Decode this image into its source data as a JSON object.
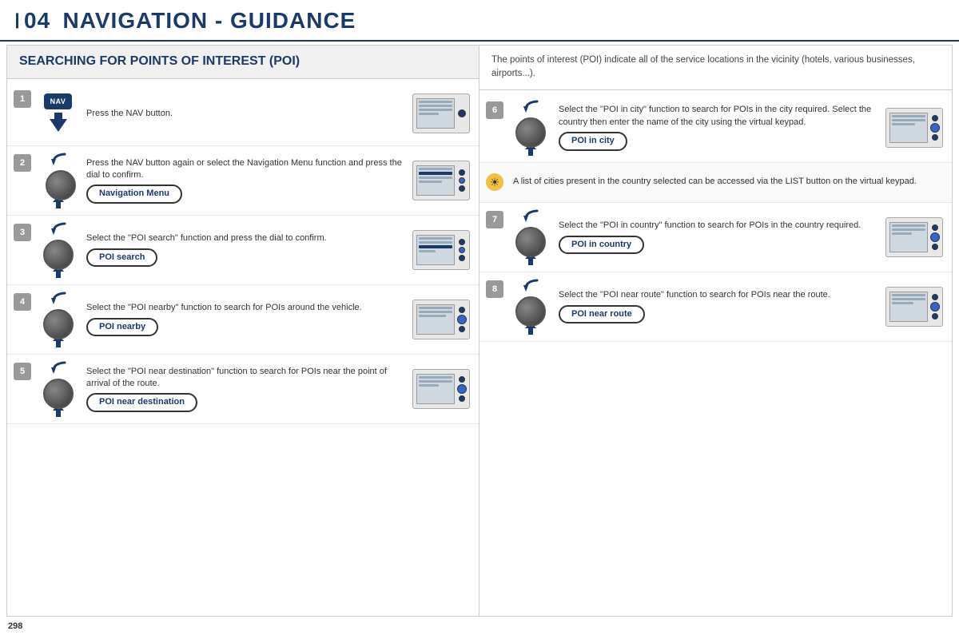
{
  "header": {
    "chapter": "04",
    "title": "NAVIGATION - GUIDANCE"
  },
  "left_section": {
    "heading": "SEARCHING FOR POINTS OF INTEREST (POI)"
  },
  "right_section": {
    "intro": "The points of interest (POI) indicate all of the service locations in the vicinity (hotels, various businesses, airports...)."
  },
  "steps_left": [
    {
      "number": "1",
      "has_nav_btn": true,
      "nav_btn_label": "NAV",
      "text": "Press the NAV button.",
      "badge": null
    },
    {
      "number": "2",
      "has_nav_btn": false,
      "text": "Press the NAV button again or select the Navigation Menu function and press the dial to confirm.",
      "badge": "Navigation Menu"
    },
    {
      "number": "3",
      "has_nav_btn": false,
      "text": "Select the \"POI search\" function and press the dial to confirm.",
      "badge": "POI search"
    },
    {
      "number": "4",
      "has_nav_btn": false,
      "text": "Select the \"POI nearby\" function to search for POIs around the vehicle.",
      "badge": "POI nearby"
    },
    {
      "number": "5",
      "has_nav_btn": false,
      "text": "Select the \"POI near destination\" function to search for POIs near the point of arrival of the route.",
      "badge": "POI near destination"
    }
  ],
  "steps_right": [
    {
      "number": "6",
      "text": "Select the \"POI in city\" function to search for POIs in the city required. Select the country then enter the name of the city using the virtual keypad.",
      "badge": "POI in city"
    },
    {
      "number": "7",
      "text": "Select the \"POI in country\" function to search for POIs in the country required.",
      "badge": "POI in country"
    },
    {
      "number": "8",
      "text": "Select the \"POI near route\" function to search for POIs near the route.",
      "badge": "POI near route"
    }
  ],
  "special_note": {
    "text": "A list of cities present in the country selected can be accessed via the LIST button on the virtual keypad."
  },
  "footer": {
    "page_number": "298"
  }
}
